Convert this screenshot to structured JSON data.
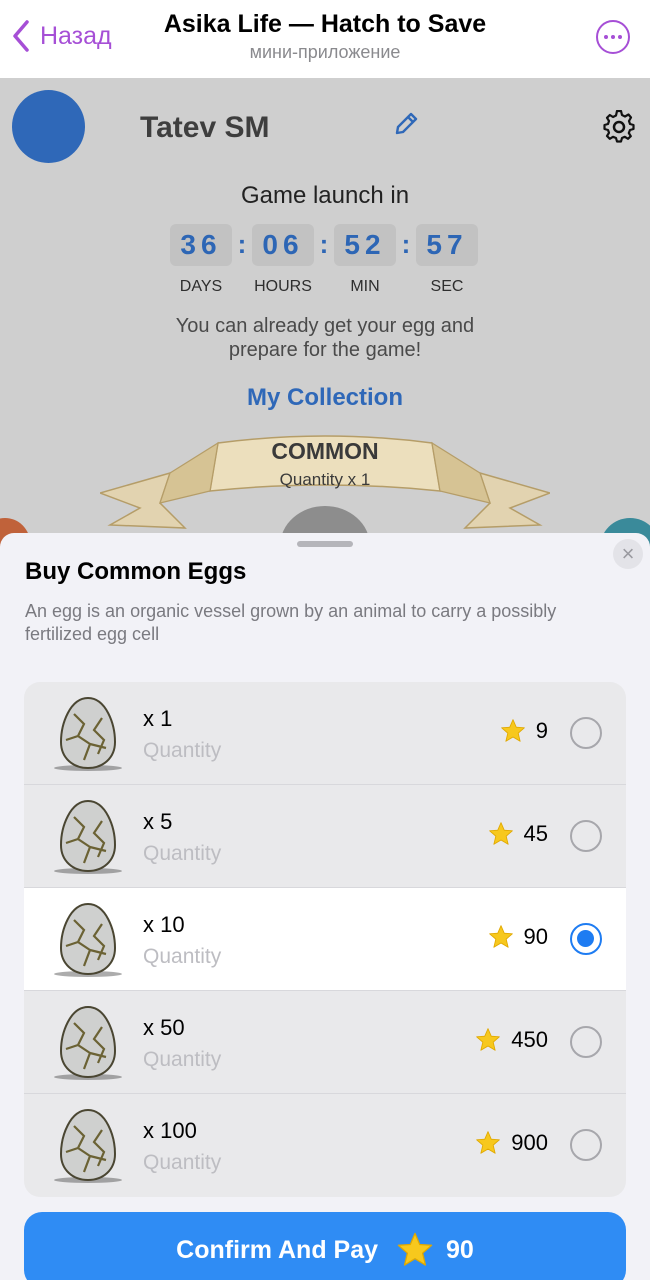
{
  "topbar": {
    "back_label": "Назад",
    "title": "Asika Life — Hatch to Save",
    "subtitle": "мини-приложение",
    "accent_color": "#a64fd6",
    "icons": [
      "chevron-left-icon",
      "more-icon"
    ]
  },
  "game": {
    "username": "Tatev SM",
    "launch_label": "Game launch in",
    "countdown": [
      {
        "value": "36",
        "label": "DAYS"
      },
      {
        "value": "06",
        "label": "HOURS"
      },
      {
        "value": "52",
        "label": "MIN"
      },
      {
        "value": "57",
        "label": "SEC"
      }
    ],
    "separator": ":",
    "info_line1": "You can already get your egg and",
    "info_line2": "prepare for the game!",
    "collection_link": "My Collection",
    "rarity": "COMMON",
    "rarity_quantity": "Quantity x 1",
    "icons": [
      "pencil-icon",
      "gear-icon"
    ]
  },
  "sheet": {
    "title": "Buy Common Eggs",
    "description": "An egg is an organic vessel grown by an animal to carry a possibly fertilized egg cell",
    "options": [
      {
        "qty": "x 1",
        "sub": "Quantity",
        "price": "9",
        "selected": false
      },
      {
        "qty": "x 5",
        "sub": "Quantity",
        "price": "45",
        "selected": false
      },
      {
        "qty": "x 10",
        "sub": "Quantity",
        "price": "90",
        "selected": true
      },
      {
        "qty": "x 50",
        "sub": "Quantity",
        "price": "450",
        "selected": false
      },
      {
        "qty": "x 100",
        "sub": "Quantity",
        "price": "900",
        "selected": false
      }
    ],
    "pay_label": "Confirm And Pay",
    "pay_amount": "90",
    "pay_color": "#2f8cf4",
    "selected_color": "#1e7cf2",
    "star_color": "#f7c81d"
  }
}
